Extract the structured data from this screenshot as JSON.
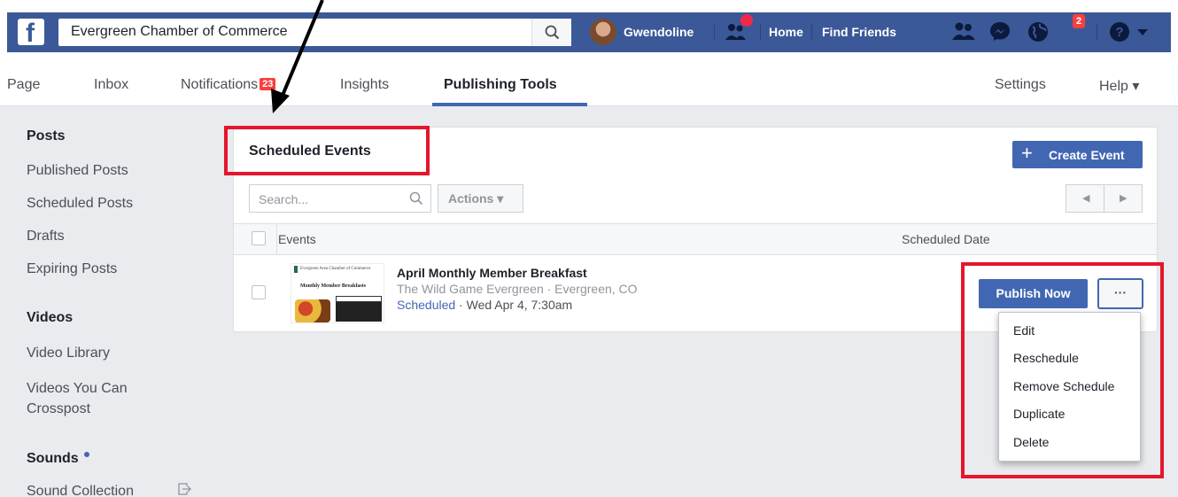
{
  "header": {
    "search_value": "Evergreen Chamber of Commerce",
    "user_name": "Gwendoline",
    "nav_home": "Home",
    "nav_find_friends": "Find Friends",
    "notifications_badge": "2"
  },
  "tabs": {
    "page": "Page",
    "inbox": "Inbox",
    "notifications": "Notifications",
    "notifications_count": "23",
    "insights": "Insights",
    "publishing_tools": "Publishing Tools",
    "settings": "Settings",
    "help": "Help ▾"
  },
  "sidebar": {
    "posts_heading": "Posts",
    "published_posts": "Published Posts",
    "scheduled_posts": "Scheduled Posts",
    "drafts": "Drafts",
    "expiring_posts": "Expiring Posts",
    "videos_heading": "Videos",
    "video_library": "Video Library",
    "crosspost_line1": "Videos You Can",
    "crosspost_line2": "Crosspost",
    "sounds_heading": "Sounds",
    "sound_collection": "Sound Collection"
  },
  "panel": {
    "title": "Scheduled Events",
    "create_event": "Create Event",
    "search_placeholder": "Search...",
    "actions": "Actions ▾",
    "col_events": "Events",
    "col_scheduled_date": "Scheduled Date"
  },
  "event": {
    "title": "April Monthly Member Breakfast",
    "location": "The Wild Game Evergreen · Evergreen, CO",
    "status": "Scheduled",
    "date": " · Wed Apr 4, 7:30am",
    "thumb_text1": "Evergreen Area Chamber of Commerce",
    "thumb_text2": "Monthly Member Breakfasts",
    "publish_now": "Publish Now",
    "more": "···"
  },
  "menu": {
    "items": [
      "Edit",
      "Reschedule",
      "Remove Schedule",
      "Duplicate",
      "Delete"
    ]
  },
  "colors": {
    "facebook_blue": "#3b5998",
    "button_blue": "#4267b2",
    "annotation_red": "#e5152c"
  }
}
